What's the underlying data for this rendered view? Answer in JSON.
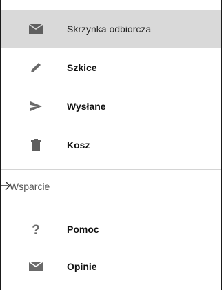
{
  "nav": {
    "items": [
      {
        "label": "Skrzynka odbiorcza",
        "icon": "mail-icon",
        "active": true
      },
      {
        "label": "Szkice",
        "icon": "pencil-icon",
        "active": false
      },
      {
        "label": "Wysłane",
        "icon": "send-icon",
        "active": false
      },
      {
        "label": "Kosz",
        "icon": "trash-icon",
        "active": false
      }
    ]
  },
  "support": {
    "header": "Wsparcie",
    "items": [
      {
        "label": "Pomoc",
        "icon": "help-icon"
      },
      {
        "label": "Opinie",
        "icon": "feedback-mail-icon"
      }
    ]
  },
  "colors": {
    "active_background": "#d9d9d9",
    "icon": "#5f5f5f",
    "divider": "#d4d4d4"
  }
}
